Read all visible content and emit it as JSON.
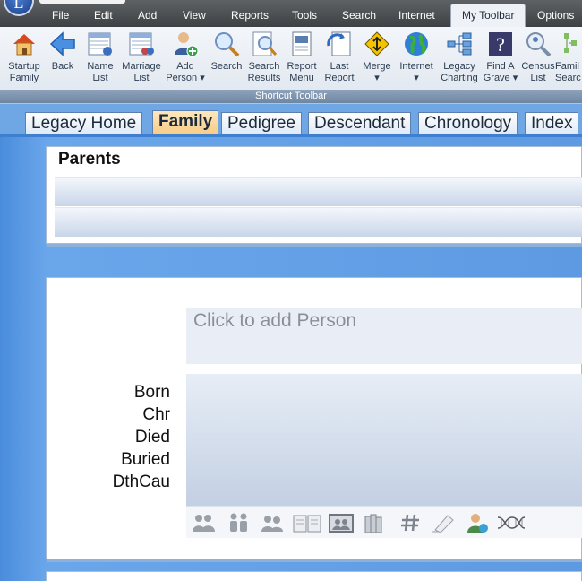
{
  "app": {
    "orb_letter": "L"
  },
  "menu": [
    {
      "label": "File"
    },
    {
      "label": "Edit"
    },
    {
      "label": "Add"
    },
    {
      "label": "View"
    },
    {
      "label": "Reports"
    },
    {
      "label": "Tools"
    },
    {
      "label": "Search"
    },
    {
      "label": "Internet"
    },
    {
      "label": "My Toolbar",
      "active": true
    },
    {
      "label": "Options"
    }
  ],
  "ribbon": {
    "group_label": "Shortcut Toolbar",
    "buttons": [
      {
        "label": "Startup\nFamily",
        "icon": "house-icon"
      },
      {
        "label": "Back",
        "icon": "back-arrow-icon"
      },
      {
        "label": "Name\nList",
        "icon": "name-list-icon"
      },
      {
        "label": "Marriage\nList",
        "icon": "marriage-list-icon"
      },
      {
        "label": "Add\nPerson ▾",
        "icon": "add-person-icon"
      },
      {
        "label": "Search",
        "icon": "magnifier-icon"
      },
      {
        "label": "Search\nResults",
        "icon": "search-results-icon"
      },
      {
        "label": "Report\nMenu",
        "icon": "report-menu-icon"
      },
      {
        "label": "Last\nReport",
        "icon": "last-report-icon"
      },
      {
        "label": "Merge\n▾",
        "icon": "merge-icon"
      },
      {
        "label": "Internet\n▾",
        "icon": "globe-icon"
      },
      {
        "label": "Legacy\nCharting",
        "icon": "charting-icon"
      },
      {
        "label": "Find A\nGrave ▾",
        "icon": "find-a-grave-icon"
      },
      {
        "label": "Census\nList",
        "icon": "census-list-icon"
      },
      {
        "label": "Famil\nSearc",
        "icon": "family-search-icon"
      }
    ]
  },
  "tabs": [
    {
      "label": "Legacy Home"
    },
    {
      "label": "Family",
      "active": true
    },
    {
      "label": "Pedigree"
    },
    {
      "label": "Descendant"
    },
    {
      "label": "Chronology"
    },
    {
      "label": "Index"
    }
  ],
  "parents": {
    "title": "Parents"
  },
  "person": {
    "placeholder": "Click to add Person",
    "vitals": [
      "Born",
      "Chr",
      "Died",
      "Buried",
      "DthCau"
    ]
  },
  "person_tools": [
    "family-group-icon",
    "children-icon",
    "spouses-icon",
    "sources-book-icon",
    "picture-icon",
    "library-books-icon",
    "hash-id-icon",
    "notes-scroll-icon",
    "user-status-icon",
    "dna-icon"
  ],
  "colors": {
    "tab_active": "#f7c981",
    "main_bg": "#5d9ae2",
    "menubar": "#4a4d50"
  }
}
